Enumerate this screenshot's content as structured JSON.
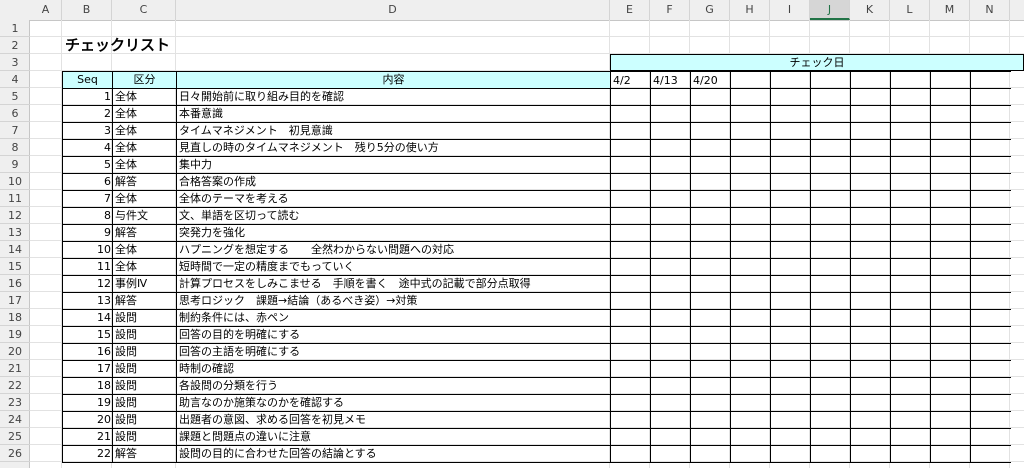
{
  "sheet": {
    "columns": [
      "A",
      "B",
      "C",
      "D",
      "E",
      "F",
      "G",
      "H",
      "I",
      "J",
      "K",
      "L",
      "M",
      "N"
    ],
    "selected_column": "J",
    "rows": [
      1,
      2,
      3,
      4,
      5,
      6,
      7,
      8,
      9,
      10,
      11,
      12,
      13,
      14,
      15,
      16,
      17,
      18,
      19,
      20,
      21,
      22,
      23,
      24,
      25,
      26
    ],
    "title": "チェックリスト",
    "check_header": "チェック日",
    "headers": {
      "seq": "Seq",
      "category": "区分",
      "content": "内容"
    },
    "check_dates": [
      "4/2",
      "4/13",
      "4/20",
      "",
      "",
      "",
      "",
      "",
      "",
      ""
    ],
    "items": [
      {
        "seq": "1",
        "cat": "全体",
        "content": "日々開始前に取り組み目的を確認"
      },
      {
        "seq": "2",
        "cat": "全体",
        "content": "本番意識"
      },
      {
        "seq": "3",
        "cat": "全体",
        "content": "タイムマネジメント　初見意識"
      },
      {
        "seq": "4",
        "cat": "全体",
        "content": "見直しの時のタイムマネジメント　残り5分の使い方"
      },
      {
        "seq": "5",
        "cat": "全体",
        "content": "集中力"
      },
      {
        "seq": "6",
        "cat": "解答",
        "content": "合格答案の作成"
      },
      {
        "seq": "7",
        "cat": "全体",
        "content": "全体のテーマを考える"
      },
      {
        "seq": "8",
        "cat": "与件文",
        "content": "文、単語を区切って読む"
      },
      {
        "seq": "9",
        "cat": "解答",
        "content": "突発力を強化"
      },
      {
        "seq": "10",
        "cat": "全体",
        "content": "ハプニングを想定する　　全然わからない問題への対応"
      },
      {
        "seq": "11",
        "cat": "全体",
        "content": "短時間で一定の精度までもっていく"
      },
      {
        "seq": "12",
        "cat": "事例Ⅳ",
        "content": "計算プロセスをしみこませる　手順を書く　途中式の記載で部分点取得"
      },
      {
        "seq": "13",
        "cat": "解答",
        "content": "思考ロジック　課題→結論（あるべき姿）→対策"
      },
      {
        "seq": "14",
        "cat": "設問",
        "content": "制約条件には、赤ペン"
      },
      {
        "seq": "15",
        "cat": "設問",
        "content": "回答の目的を明確にする"
      },
      {
        "seq": "16",
        "cat": "設問",
        "content": "回答の主語を明確にする"
      },
      {
        "seq": "17",
        "cat": "設問",
        "content": "時制の確認"
      },
      {
        "seq": "18",
        "cat": "設問",
        "content": "各設問の分類を行う"
      },
      {
        "seq": "19",
        "cat": "設問",
        "content": "助言なのか施策なのかを確認する"
      },
      {
        "seq": "20",
        "cat": "設問",
        "content": "出題者の意図、求める回答を初見メモ"
      },
      {
        "seq": "21",
        "cat": "設問",
        "content": "課題と問題点の違いに注意"
      },
      {
        "seq": "22",
        "cat": "解答",
        "content": "設問の目的に合わせた回答の結論とする"
      }
    ]
  }
}
